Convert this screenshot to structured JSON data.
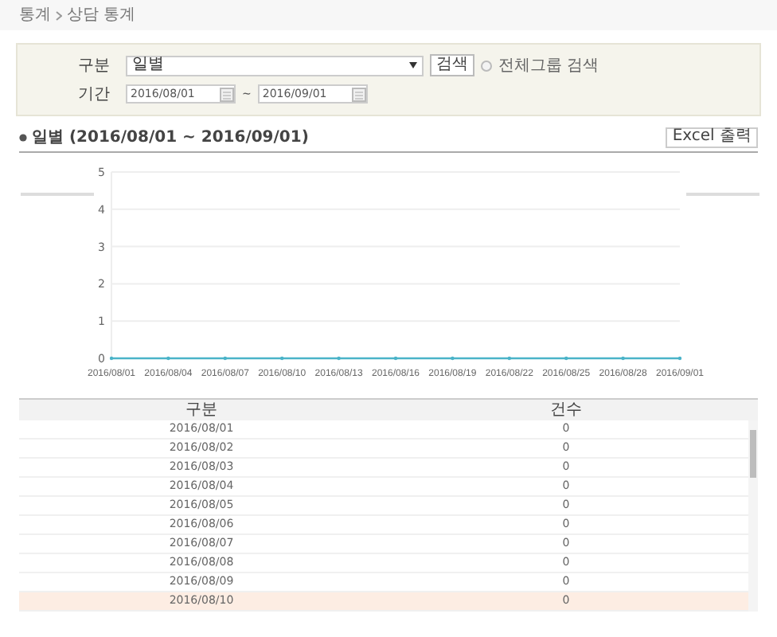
{
  "breadcrumb": [
    "통계",
    "상담 통계"
  ],
  "filter": {
    "category_label": "구분",
    "category_value": "일별",
    "search_button": "검색",
    "all_groups": {
      "label": "전체그룹 검색",
      "checked": false
    },
    "period_label": "기간",
    "start_date": "2016/08/01",
    "separator": "~",
    "end_date": "2016/09/01"
  },
  "section": {
    "title": "일별 (2016/08/01 ~ 2016/09/01)",
    "export_button": "Excel 출력"
  },
  "chart_data": {
    "type": "line",
    "categories": [
      "2016/08/01",
      "2016/08/04",
      "2016/08/07",
      "2016/08/10",
      "2016/08/13",
      "2016/08/16",
      "2016/08/19",
      "2016/08/22",
      "2016/08/25",
      "2016/08/28",
      "2016/09/01"
    ],
    "series": [
      {
        "color": "#4ab3c8",
        "values": [
          0,
          0,
          0,
          0,
          0,
          0,
          0,
          0,
          0,
          0,
          0
        ]
      }
    ],
    "ylim": [
      0,
      5
    ],
    "yticks": [
      0,
      1,
      2,
      3,
      4,
      5
    ],
    "grid": true
  },
  "table": {
    "columns": [
      "구분",
      "건수"
    ],
    "rows": [
      {
        "cells": [
          "2016/08/01",
          "0"
        ],
        "selected": false
      },
      {
        "cells": [
          "2016/08/02",
          "0"
        ],
        "selected": false
      },
      {
        "cells": [
          "2016/08/03",
          "0"
        ],
        "selected": false
      },
      {
        "cells": [
          "2016/08/04",
          "0"
        ],
        "selected": false
      },
      {
        "cells": [
          "2016/08/05",
          "0"
        ],
        "selected": false
      },
      {
        "cells": [
          "2016/08/06",
          "0"
        ],
        "selected": false
      },
      {
        "cells": [
          "2016/08/07",
          "0"
        ],
        "selected": false
      },
      {
        "cells": [
          "2016/08/08",
          "0"
        ],
        "selected": false
      },
      {
        "cells": [
          "2016/08/09",
          "0"
        ],
        "selected": false
      },
      {
        "cells": [
          "2016/08/10",
          "0"
        ],
        "selected": true
      }
    ]
  }
}
